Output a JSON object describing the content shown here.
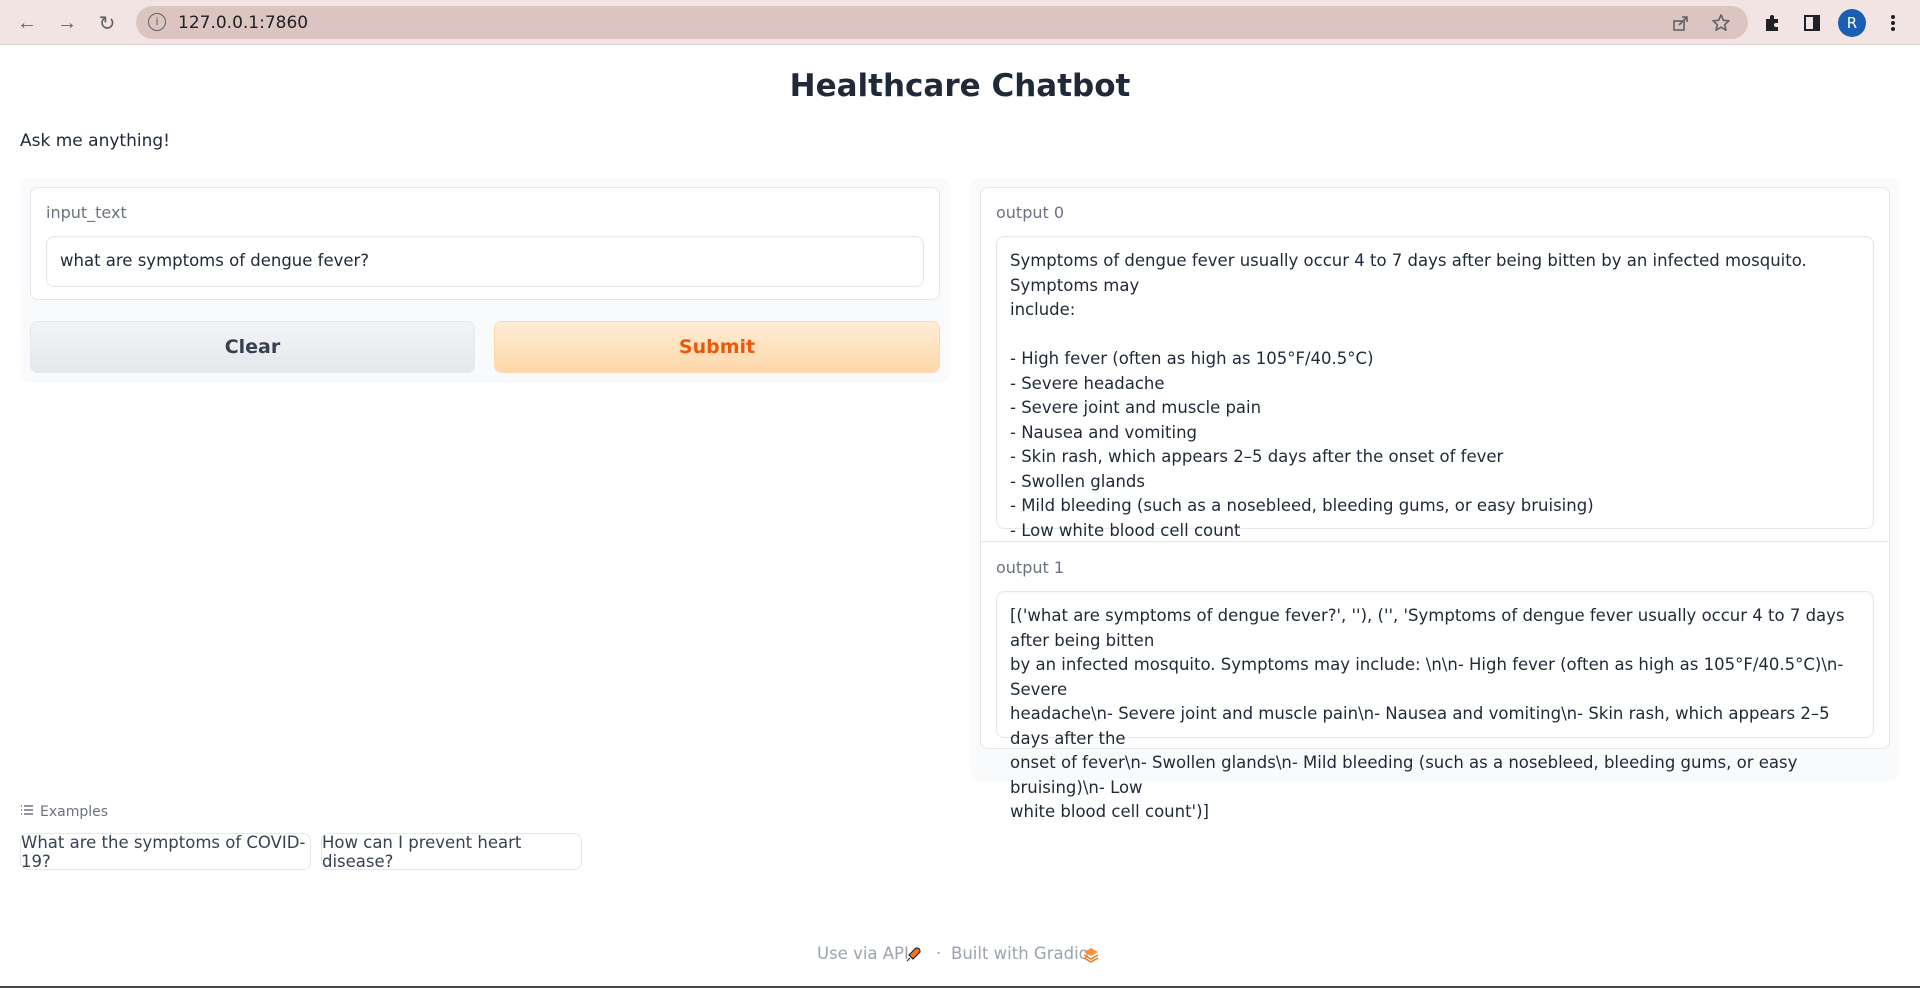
{
  "browser": {
    "url": "127.0.0.1:7860",
    "back_icon": "←",
    "forward_icon": "→",
    "reload_icon": "↻",
    "profile_initial": "R"
  },
  "page": {
    "title": "Healthcare Chatbot",
    "description": "Ask me anything!"
  },
  "input": {
    "label": "input_text",
    "value": "what are symptoms of dengue fever?"
  },
  "buttons": {
    "clear": "Clear",
    "submit": "Submit"
  },
  "outputs": [
    {
      "label": "output 0",
      "value": "Symptoms of dengue fever usually occur 4 to 7 days after being bitten by an infected mosquito. Symptoms may\ninclude:\n\n- High fever (often as high as 105°F/40.5°C)\n- Severe headache\n- Severe joint and muscle pain\n- Nausea and vomiting\n- Skin rash, which appears 2–5 days after the onset of fever\n- Swollen glands\n- Mild bleeding (such as a nosebleed, bleeding gums, or easy bruising)\n- Low white blood cell count"
    },
    {
      "label": "output 1",
      "value": "[('what are symptoms of dengue fever?', ''), ('', 'Symptoms of dengue fever usually occur 4 to 7 days after being bitten\nby an infected mosquito. Symptoms may include: \\n\\n- High fever (often as high as 105°F/40.5°C)\\n- Severe\nheadache\\n- Severe joint and muscle pain\\n- Nausea and vomiting\\n- Skin rash, which appears 2–5 days after the\nonset of fever\\n- Swollen glands\\n- Mild bleeding (such as a nosebleed, bleeding gums, or easy bruising)\\n- Low\nwhite blood cell count')]"
    }
  ],
  "examples": {
    "heading": "Examples",
    "items": [
      "What are the symptoms of COVID-19?",
      "How can I prevent heart disease?"
    ]
  },
  "footer": {
    "api_link": "Use via API",
    "separator": "·",
    "built_with": "Built with Gradio"
  },
  "colors": {
    "accent": "#ea580c",
    "submit_bg": "#fed7aa",
    "chrome_bg": "#f1e4e2"
  }
}
